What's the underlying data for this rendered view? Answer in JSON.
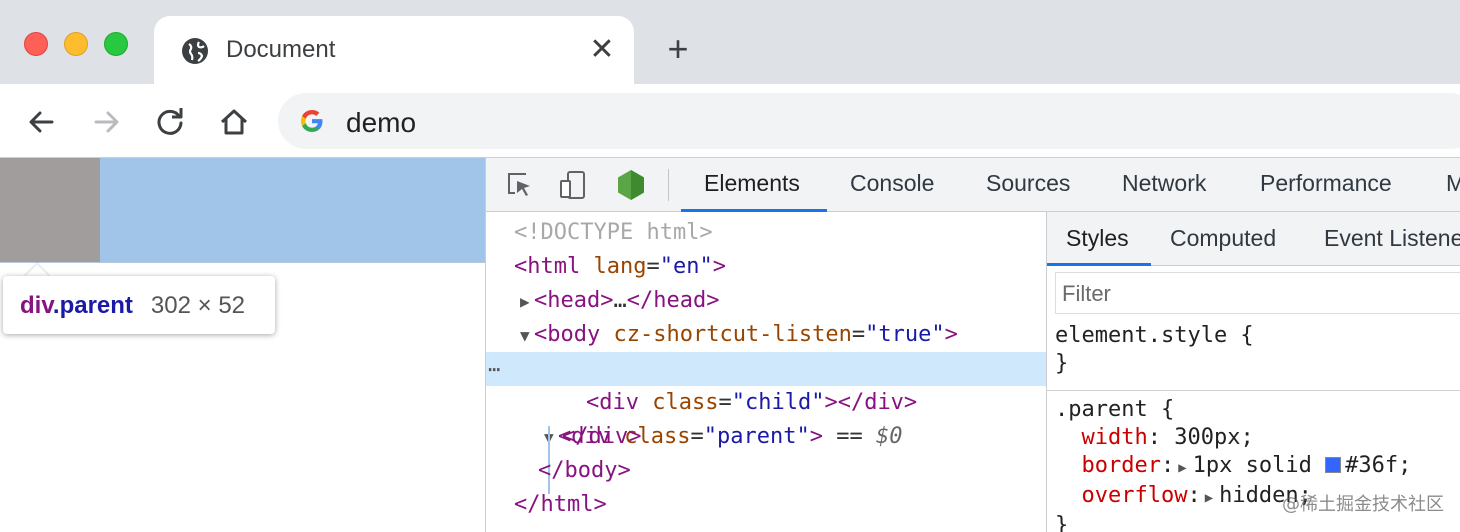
{
  "browser": {
    "tab_title": "Document",
    "close_glyph": "✕",
    "new_tab_glyph": "+",
    "url": "demo"
  },
  "viewport": {
    "tooltip_tag": "div",
    "tooltip_class": ".parent",
    "tooltip_dims": "302 × 52"
  },
  "devtools": {
    "tabs": [
      "Elements",
      "Console",
      "Sources",
      "Network",
      "Performance",
      "M"
    ],
    "active_tab": "Elements",
    "dom": {
      "doctype": "<!DOCTYPE html>",
      "html_tag": "html",
      "html_attr": "lang",
      "html_val": "\"en\"",
      "head_open": "<head>",
      "head_ellipsis": "…",
      "head_close": "</head>",
      "body_tag": "body",
      "body_attr": "cz-shortcut-listen",
      "body_val": "\"true\"",
      "div_tag": "div",
      "div_attr": "class",
      "div_val": "\"parent\"",
      "eq": "==",
      "ref": "$0",
      "child_val": "\"child\"",
      "div_close": "</div>",
      "body_close": "</body>",
      "html_close": "</html>",
      "row_menu": "⋯"
    },
    "styles_tabs": [
      "Styles",
      "Computed",
      "Event Listene"
    ],
    "filter_placeholder": "Filter",
    "css": {
      "element_style": "element.style {",
      "close_brace": "}",
      "rule_selector": ".parent {",
      "p1_name": "width",
      "p1_value": "300px;",
      "p2_name": "border",
      "p2_value_pre": "1px solid ",
      "p2_color": "#36f;",
      "p3_name": "overflow",
      "p3_value": "hidden;",
      "close_brace_2": "}"
    }
  },
  "watermark": "@稀土掘金技术社区",
  "colors": {
    "accent": "#1a73e8",
    "highlight": "#a0c5e8",
    "margin": "#a09d9c",
    "swatch": "#3366ff"
  }
}
